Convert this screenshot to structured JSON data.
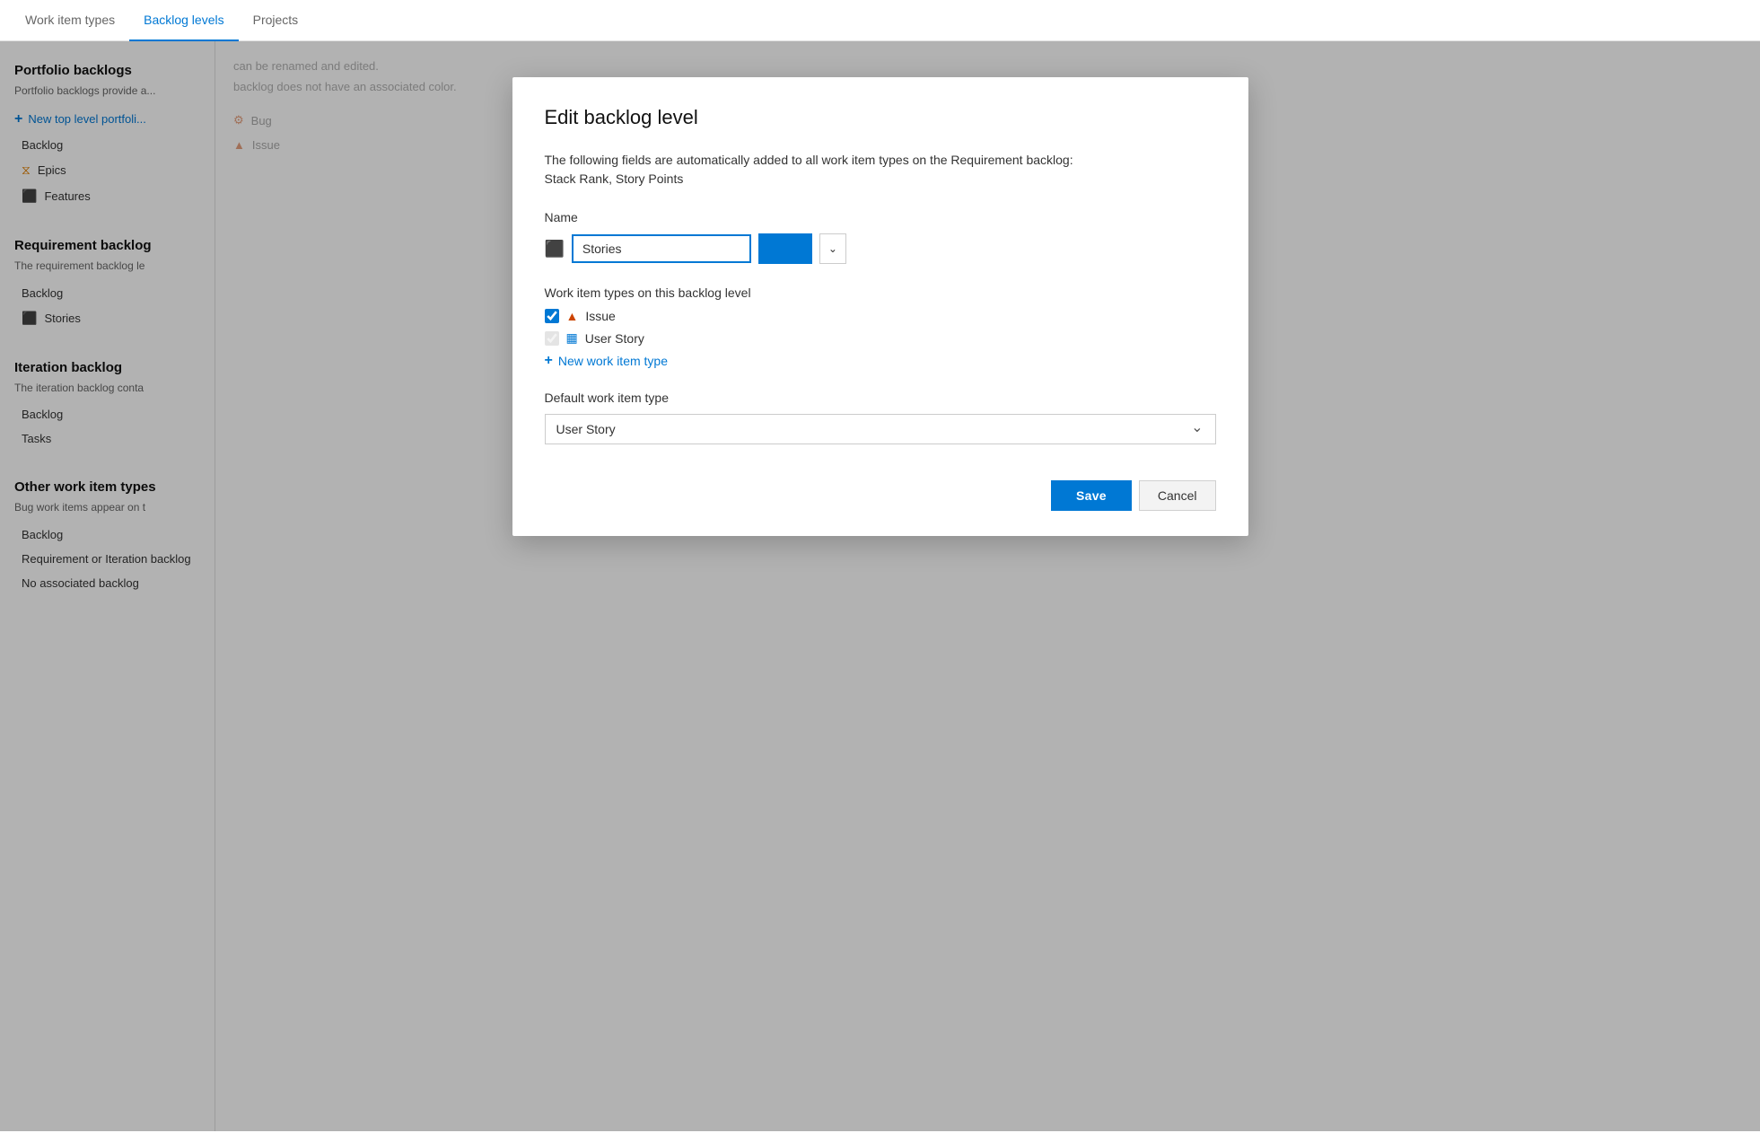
{
  "nav": {
    "tabs": [
      {
        "label": "Work item types",
        "active": false
      },
      {
        "label": "Backlog levels",
        "active": true
      },
      {
        "label": "Projects",
        "active": false
      }
    ]
  },
  "left_panel": {
    "portfolio_section": {
      "title": "Portfolio backlogs",
      "desc": "Portfolio backlogs provide a...",
      "add_link": "New top level portfoli...",
      "backlog_label": "Backlog",
      "items": [
        {
          "icon": "epics",
          "label": "Epics"
        },
        {
          "icon": "features",
          "label": "Features"
        }
      ]
    },
    "requirement_section": {
      "title": "Requirement backlog",
      "desc": "The requirement backlog le",
      "backlog_label": "Backlog",
      "items": [
        {
          "icon": "stories",
          "label": "Stories"
        }
      ]
    },
    "iteration_section": {
      "title": "Iteration backlog",
      "desc": "The iteration backlog conta",
      "backlog_label": "Backlog",
      "tasks_label": "Tasks"
    },
    "other_section": {
      "title": "Other work item types",
      "desc": "Bug work items appear on t",
      "backlog_label": "Backlog",
      "sub_items": [
        "Requirement or Iteration backlog",
        "No associated backlog"
      ]
    }
  },
  "modal": {
    "title": "Edit backlog level",
    "info_text": "The following fields are automatically added to all work item types on the Requirement backlog:",
    "info_fields": "Stack Rank, Story Points",
    "name_label": "Name",
    "name_value": "Stories",
    "color_placeholder": "",
    "work_item_types_label": "Work item types on this backlog level",
    "work_items": [
      {
        "label": "Issue",
        "checked": true,
        "disabled": false,
        "icon": "issue"
      },
      {
        "label": "User Story",
        "checked": true,
        "disabled": true,
        "icon": "userstory"
      }
    ],
    "add_wit_label": "New work item type",
    "default_wit_label": "Default work item type",
    "default_wit_value": "User Story",
    "save_label": "Save",
    "cancel_label": "Cancel"
  },
  "right_panel": {
    "lines": [
      "can be renamed and edited.",
      "backlog does not have an associated color."
    ],
    "bottom_items": [
      {
        "label": "Bug",
        "icon": "bug"
      },
      {
        "label": "Issue",
        "icon": "issue"
      }
    ]
  }
}
